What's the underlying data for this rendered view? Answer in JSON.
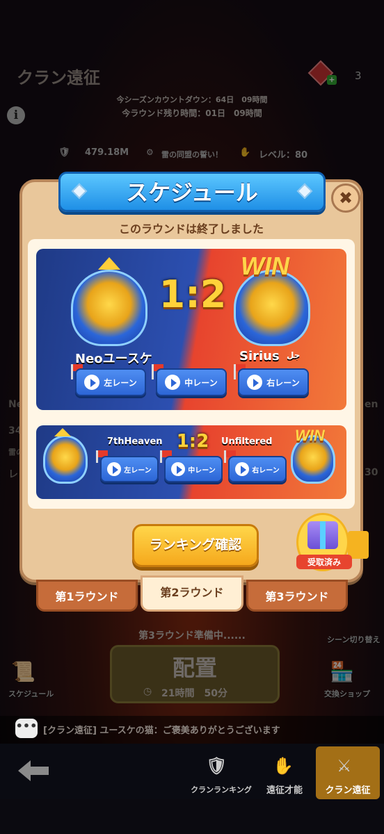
{
  "header": {
    "title": "クラン遠征",
    "gem_count": "3",
    "gem_plus": "+"
  },
  "countdown": {
    "season": "今シーズンカウントダウン：64日　09時間",
    "round": "今ラウンド残り時間：01日　09時間"
  },
  "stats": {
    "power": "479.18M",
    "oath": "雷の同盟の誓い！",
    "level": "レベル：80"
  },
  "modal": {
    "title": "スケジュール",
    "close": "✖",
    "status": "このラウンドは終了しました",
    "match_main": {
      "score": "1:2",
      "win_label": "WIN",
      "left_team": "Neoユースケ",
      "right_team": "Sirius",
      "right_suffix": "جل",
      "lanes": [
        "左レーン",
        "中レーン",
        "右レーン"
      ]
    },
    "match_sub": {
      "score": "1:2",
      "win_label": "WIN",
      "left_team": "7thHeaven",
      "right_team": "Unfiltered",
      "lanes": [
        "左レーン",
        "中レーン",
        "右レーン"
      ]
    },
    "ranking_button": "ランキング確認",
    "gift_label": "受取済み",
    "tabs": [
      "第1ラウンド",
      "第2ラウンド",
      "第3ラウンド"
    ],
    "active_tab": 1
  },
  "background": {
    "prep_text": "第3ラウンド準備中......",
    "deploy_label": "配置",
    "deploy_timer": "21時間　50分",
    "schedule_label": "スケジュール",
    "scene_switch": "シーン切り替え",
    "exchange_shop": "交換ショップ",
    "left_fragments": [
      "Ne",
      "34",
      "雷の",
      "レ"
    ],
    "right_fragments": [
      "en",
      "30"
    ]
  },
  "chat": {
    "message": "[クラン遠征] ユースケの猫：ご褒美ありがとうございます"
  },
  "nav": {
    "items": [
      "クランランキング",
      "遠征才能",
      "クラン遠征"
    ],
    "active": 2
  },
  "colors": {
    "blue_team": "#2c4fb0",
    "red_team": "#e7442e",
    "gold": "#ffd23a",
    "panel": "#e9c79b"
  }
}
